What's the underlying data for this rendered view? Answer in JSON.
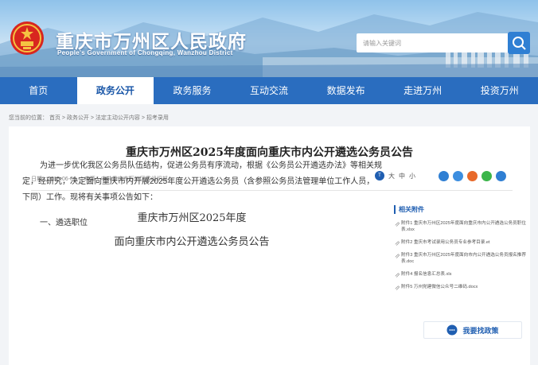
{
  "header": {
    "site_title": "重庆市万州区人民政府",
    "site_subtitle": "People's Government of Chongqing, Wanzhou District",
    "search_placeholder": "请输入关键词"
  },
  "nav": {
    "items": [
      "首页",
      "政务公开",
      "政务服务",
      "互动交流",
      "数据发布",
      "走进万州",
      "投资万州"
    ],
    "active_index": 1
  },
  "breadcrumb": "您当前的位置：  首页 > 政务公开 > 法定主动公开内容 > 招考录用",
  "article": {
    "title": "重庆市万州区2025年度面向重庆市内公开遴选公务员公告",
    "date_label": "日期：",
    "date": "2025-06-06",
    "source_label": "来源：",
    "source": "中共重庆市万州区委组织部",
    "font_sizes": [
      "大",
      "中",
      "小"
    ],
    "body_title_line1": "重庆市万州区2025年度",
    "body_title_line2": "面向重庆市内公开遴选公务员公告",
    "paragraph": "为进一步优化我区公务员队伍结构，促进公务员有序流动，根据《公务员公开遴选办法》等相关规定，经研究，决定面向重庆市内开展2025年度公开遴选公务员（含参照公务员法管理单位工作人员，下同）工作。现将有关事项公告如下：",
    "section1": "一、遴选职位"
  },
  "related": {
    "title": "相关附件",
    "items": [
      "附件1 重庆市万州区2025年度面向重庆市内公开遴选公务员职位表.xlsx",
      "附件2 重庆市考试录用公务员专业参考目录.et",
      "附件3 重庆市万州区2025年度面向市内公开遴选公务员报名推荐表.doc",
      "附件4 报名信息汇总表.xls",
      "附件5 万州党建微信公众号二维码.docx"
    ],
    "policy_button": "我要找政策"
  },
  "colors": {
    "nav_bg": "#2a6dbf",
    "accent": "#1f5eb1"
  }
}
